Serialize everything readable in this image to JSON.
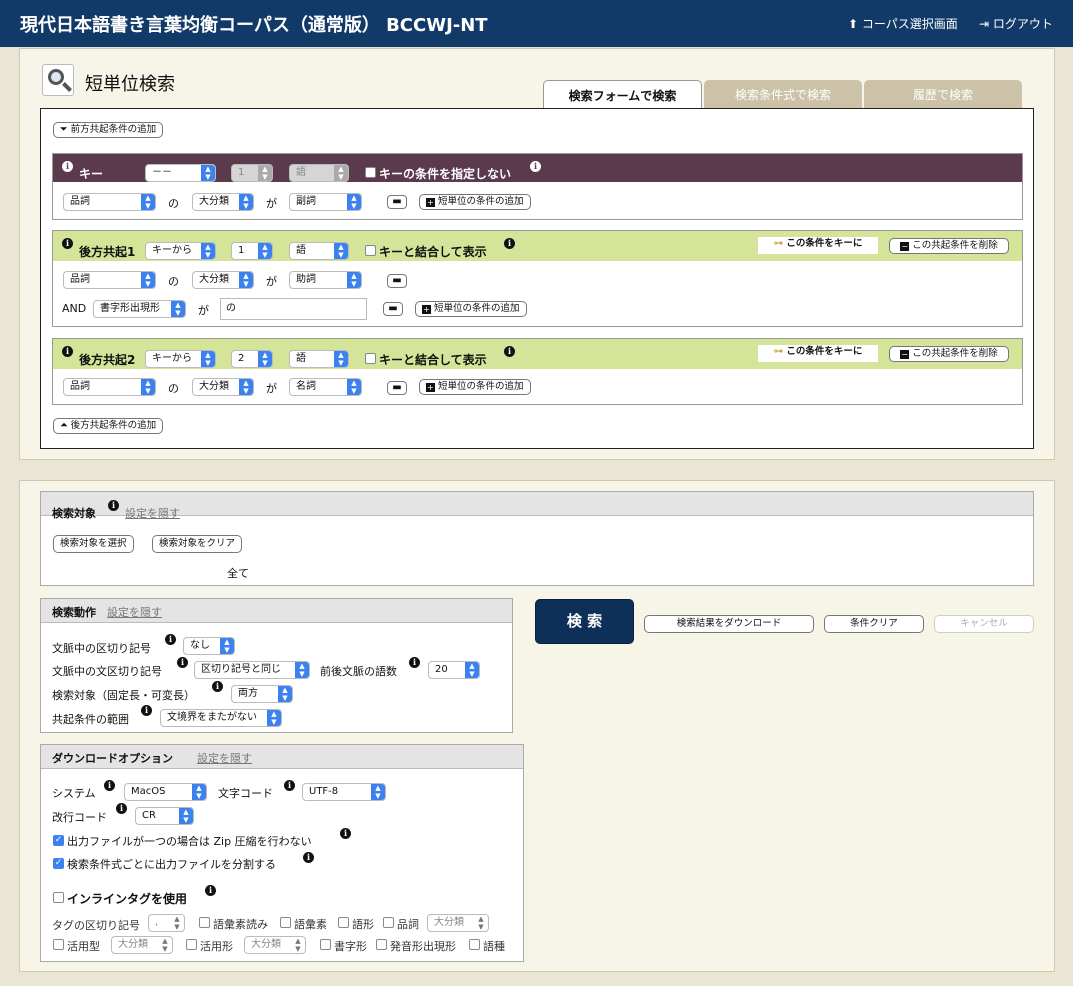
{
  "header": {
    "title": "現代日本語書き言葉均衡コーパス（通常版） BCCWJ-NT",
    "corpus_select": "コーパス選択画面",
    "logout": "ログアウト"
  },
  "page": {
    "title": "短単位検索"
  },
  "tabs": [
    {
      "label": "検索フォームで検索"
    },
    {
      "label": "検索条件式で検索"
    },
    {
      "label": "履歴で検索"
    }
  ],
  "common": {
    "no": "の",
    "ga": "が",
    "and": "AND",
    "add_prev": "前方共起条件の追加",
    "add_next": "後方共起条件の追加",
    "add_unit": "短単位の条件の追加",
    "make_key": "この条件をキーに",
    "delete_cond": "この共起条件を削除",
    "combine": "キーと結合して表示",
    "cat": "大分類"
  },
  "key": {
    "label": "キー",
    "sel1": "－－",
    "sel2": "1",
    "sel3": "語",
    "no_cond": "キーの条件を指定しない",
    "attr": "品詞",
    "val": "副詞"
  },
  "next1": {
    "label": "後方共起1",
    "from": "キーから",
    "num": "1",
    "unit": "語",
    "attr": "品詞",
    "val": "助詞",
    "attr2": "書字形出現形",
    "input": "の"
  },
  "next2": {
    "label": "後方共起2",
    "from": "キーから",
    "num": "2",
    "unit": "語",
    "attr": "品詞",
    "val": "名詞"
  },
  "target": {
    "title": "検索対象",
    "hide": "設定を隠す",
    "select_btn": "検索対象を選択",
    "clear_btn": "検索対象をクリア",
    "value": "全て"
  },
  "action": {
    "title": "検索動作",
    "hide": "設定を隠す",
    "ctx_sep": "文脈中の区切り記号",
    "ctx_sep_val": "なし",
    "sent_sep": "文脈中の文区切り記号",
    "sent_sep_val": "区切り記号と同じ",
    "ctx_words": "前後文脈の語数",
    "ctx_words_val": "20",
    "target": "検索対象（固定長・可変長）",
    "target_val": "両方",
    "range": "共起条件の範囲",
    "range_val": "文境界をまたがない"
  },
  "buttons": {
    "search": "検 索",
    "download": "検索結果をダウンロード",
    "clear": "条件クリア",
    "cancel": "キャンセル"
  },
  "download": {
    "title": "ダウンロードオプション",
    "hide": "設定を隠す",
    "system": "システム",
    "system_val": "MacOS",
    "charcode": "文字コード",
    "charcode_val": "UTF-8",
    "newline": "改行コード",
    "newline_val": "CR",
    "nozip": "出力ファイルが一つの場合は Zip 圧縮を行わない",
    "split": "検索条件式ごとに出力ファイルを分割する",
    "inline": "インラインタグを使用",
    "tag_sep": "タグの区切り記号",
    "tag_sep_val": ",",
    "opts": [
      "語彙素読み",
      "語彙素",
      "語形",
      "品詞"
    ],
    "cat": "大分類",
    "conj_type": "活用型",
    "conj_form": "活用形",
    "written": "書字形",
    "pron": "発音形出現形",
    "wtype": "語種"
  },
  "colors": {
    "header": "#123a69",
    "key_band": "#5b3a4e",
    "cooc_band": "#d4e59a",
    "search_btn": "#0e2f58",
    "check": "#3b82f0"
  }
}
